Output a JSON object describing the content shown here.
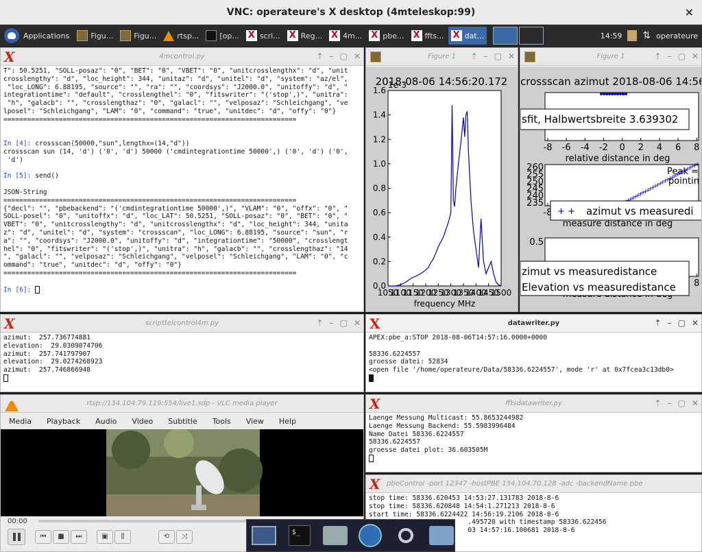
{
  "vnc": {
    "title": "VNC: operateure's X desktop (4mteleskop:99)",
    "close": "×"
  },
  "taskbar": {
    "applications": "Applications",
    "tasks": [
      {
        "label": "Figu...",
        "icon": "figure-icon"
      },
      {
        "label": "Figu...",
        "icon": "figure-icon"
      },
      {
        "label": "rtsp...",
        "icon": "vlc-icon"
      },
      {
        "label": "[op...",
        "icon": "terminal-icon"
      },
      {
        "label": "scri...",
        "icon": "xterm-icon"
      },
      {
        "label": "Reg...",
        "icon": "xterm-icon"
      },
      {
        "label": "4m...",
        "icon": "xterm-icon"
      },
      {
        "label": "pbe...",
        "icon": "xterm-icon"
      },
      {
        "label": "ffts...",
        "icon": "xterm-icon"
      },
      {
        "label": "dat...",
        "icon": "xterm-icon"
      }
    ],
    "clock": "14:59",
    "user": "operateure"
  },
  "control_window": {
    "title": "4mcontrol.py",
    "lines": [
      "T\": 50.5251, \"SOLL-posaz\": \"0\", \"BET\": \"0\", \"VBET\": \"0\", \"unitcrosslengthx\": \"d\", \"unit",
      "crosslengthy\": \"d\", \"loc_height\": 344, \"unitaz\": \"d\", \"unitel\": \"d\", \"system\": \"az/el\",",
      " \"loc_LONG\": 6.88195, \"source\": \"\", \"ra\": \"\", \"coordsys\": \"J2000.0\", \"unitoffy\": \"d\", \"",
      "integrationtime\": \"default\", \"crosslengthel\": \"0\", \"fitswriter\": \"('stop',)\", \"unitra\":",
      " \"h\", \"galacb\": \"\", \"crosslengthaz\": \"0\", \"galacl\": \"\", \"velposaz\": \"Schleichgang\", \"ve",
      "lposel\": \"Schleichgang\", \"LAM\": \"0\", \"command\": \"true\", \"unitdec\": \"d\", \"offy\": \"0\"}",
      "==========================================================================",
      "",
      ""
    ],
    "prompt4": "In [4]: ",
    "cmd4": "crossscan(50000,\"sun\",lengthx=(14,\"d\"))",
    "out4": [
      "crossscan sun (14, 'd') ('0', 'd') 50000 ('cmdintegrationtime 50000',) ('0', 'd') ('0',",
      " 'd')",
      ""
    ],
    "prompt5": "In [5]: ",
    "cmd5": "send()",
    "out5": [
      "",
      "JSON-String",
      "==========================================================================",
      "{\"decl\": \"\", \"pbebackend\": \"('cmdintegrationtime 50000',)\", \"VLAM\": \"0\", \"offx\": \"0\", \"",
      "SOLL-posel\": \"0\", \"unitoffx\": \"d\", \"loc_LAT\": 50.5251, \"SOLL-posaz\": \"0\", \"BET\": \"0\", \"",
      "VBET\": \"0\", \"unitcrosslengthy\": \"d\", \"unitcrosslengthx\": \"d\", \"loc_height\": 344, \"unita",
      "z\": \"d\", \"unitel\": \"d\", \"system\": \"crossscan\", \"loc_LONG\": 6.88195, \"source\": \"sun\", \"r",
      "a\": \"\", \"coordsys\": \"J2000.0\", \"unitoffy\": \"d\", \"integrationtime\": \"50000\", \"crosslengt",
      "hel\": \"0\", \"fitswriter\": \"('stop',)\", \"unitra\": \"h\", \"galacb\": \"\", \"crosslengthaz\": \"14",
      "\", \"galacl\": \"\", \"velposaz\": \"Schleichgang\", \"velposel\": \"Schleichgang\", \"LAM\": \"0\", \"c",
      "ommand\": \"true\", \"unitdec\": \"d\", \"offy\": \"0\"}",
      "==========================================================================",
      ""
    ],
    "prompt6": "In [6]: "
  },
  "figure1": {
    "title": "Figure 1"
  },
  "figure2": {
    "title": "Figure 1"
  },
  "scripttel": {
    "title": "scripttelcontrol4m.py",
    "lines": [
      "azimut:  257.736774881",
      "elevation:  29.0309074706",
      "azimut:  257.741797907",
      "elevation:  29.0274268923",
      "azimut:  257.746866948"
    ]
  },
  "datawriter": {
    "title": "datawriter.py",
    "lines": [
      "APEX:pbe_a:STOP 2018-08-06T14:57:16.0000+0000",
      "",
      "58336.6224557",
      "groesse datei: 52834",
      "<open file '/home/operateure/Data/58336.6224557', mode 'r' at 0x7fcea3c13db0>"
    ]
  },
  "vlc": {
    "title": "rtsp://134.104.79.119:554/live1.sdp - VLC media player",
    "menu": [
      "Media",
      "Playback",
      "Audio",
      "Video",
      "Subtitle",
      "Tools",
      "View",
      "Help"
    ],
    "time": "00:00"
  },
  "fftsdatawriter": {
    "title": "fftsdatawriter.py",
    "lines": [
      "Laenge Messung Multicast: 55.8653244982",
      "Laenge Messung Backend: 55.5983996484",
      "Name Datei 58336.6224557",
      "58336.6224557",
      "groesse datei plot: 36.603505M"
    ]
  },
  "pbecontrol": {
    "title": "pbeControl -port 12347 -hostPBE 134.104.70.128 -adc -backendName pbe",
    "lines": [
      "stop time: 58336.620453 14:53:27.131783 2018-8-6",
      "stop time: 58336.620848 14:54:1.271213 2018-8-6",
      "start time: 58336.6224422 14:56:19.2106 2018-8-6",
      "                         .495720 with timestamp 58336.622456",
      "                         03 14:57:16.100681 2018-8-6"
    ]
  },
  "chart_data": [
    {
      "type": "line",
      "title": "2018-08-06 14:56:20.172",
      "xlabel": "frequency MHz",
      "ylabel": "",
      "scale_label": "1e-3",
      "xlim": [
        1050,
        1500
      ],
      "ylim": [
        0.0,
        1.6
      ],
      "xticks": [
        "1050",
        "1100",
        "1150",
        "1200",
        "1250",
        "1300",
        "1350",
        "1400",
        "1450",
        "1500"
      ],
      "yticks": [
        "0.0",
        "0.2",
        "0.4",
        "0.6",
        "0.8",
        "1.0",
        "1.2",
        "1.4",
        "1.6"
      ],
      "series": [
        {
          "x": [
            1050,
            1080,
            1100,
            1120,
            1140,
            1160,
            1180,
            1200,
            1210,
            1220,
            1230,
            1240,
            1250,
            1260,
            1270,
            1280,
            1290,
            1300,
            1305,
            1310,
            1315,
            1320,
            1330,
            1340,
            1350,
            1355,
            1360,
            1365,
            1370,
            1380,
            1390,
            1400,
            1410,
            1420,
            1430,
            1440,
            1450,
            1460,
            1470,
            1480,
            1490,
            1500
          ],
          "y": [
            0.0,
            0.0,
            0.01,
            0.03,
            0.06,
            0.08,
            0.1,
            0.13,
            0.15,
            0.19,
            0.22,
            0.27,
            0.32,
            0.36,
            0.4,
            0.46,
            0.52,
            0.6,
            1.48,
            0.7,
            0.65,
            0.8,
            1.0,
            1.18,
            1.38,
            1.22,
            1.4,
            1.43,
            1.1,
            0.7,
            0.45,
            0.3,
            0.15,
            0.55,
            0.2,
            0.1,
            0.15,
            0.2,
            0.1,
            0.03,
            0.01,
            0.0
          ]
        }
      ]
    },
    {
      "type": "scatter",
      "title": "crossscan azimut 2018-08-06 14:56:",
      "panels": [
        {
          "xlabel": "relative distance in deg",
          "legend": [
            "sfit, Halbwertsbreite 3.639302"
          ],
          "side_text": [
            "Peak =",
            "pointin"
          ],
          "xticks": [
            "-8",
            "-6",
            "-4",
            "-2",
            "0",
            "2",
            "4",
            "6",
            "8"
          ]
        },
        {
          "xlabel": "measure distance in deg",
          "legend": [
            "azimut vs measuredi"
          ],
          "ylim": [
            235,
            260
          ],
          "yticks": [
            "235",
            "240",
            "245",
            "250",
            "255",
            "260"
          ],
          "xticks": [
            "-8",
            "-6",
            "-4",
            "-2",
            "0",
            "2",
            "4",
            "6",
            "8"
          ]
        },
        {
          "xlabel": "measure distance in deg",
          "legend": [
            "zimut vs measuredistance",
            "Elevation vs measuredistance"
          ],
          "yticks": [
            "0.5"
          ],
          "xticks": [
            "-8",
            "-6",
            "-4",
            "-2",
            "0",
            "2",
            "4",
            "6",
            "8"
          ]
        }
      ]
    }
  ]
}
